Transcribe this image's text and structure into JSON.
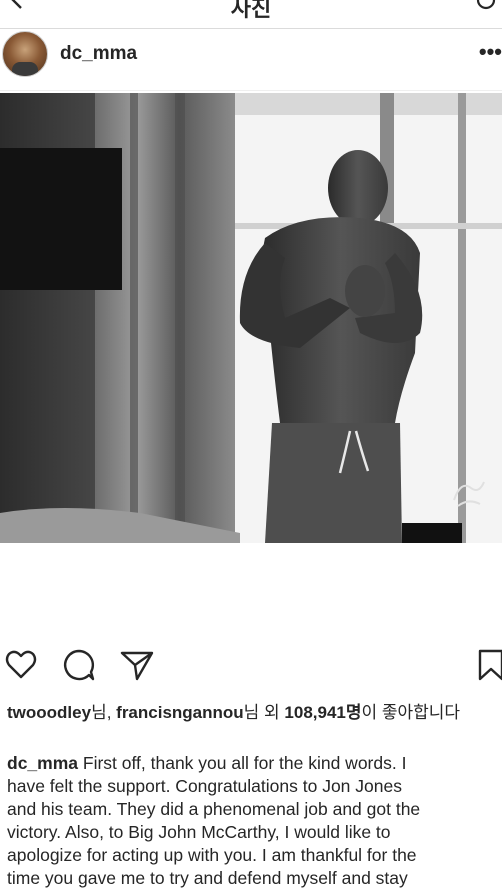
{
  "topbar": {
    "title": "사진",
    "back_icon": "back-arrow-icon",
    "reload_icon": "refresh-icon"
  },
  "post": {
    "username": "dc_mma",
    "more_label": "•••",
    "actions": {
      "like_icon": "heart-icon",
      "comment_icon": "comment-icon",
      "share_icon": "send-icon",
      "save_icon": "bookmark-icon"
    },
    "likes": {
      "user1": "twooodley",
      "suffix1": "님, ",
      "user2": "francisngannou",
      "middle": "님 외 ",
      "count": "108,941명",
      "end": "이 좋아합니다"
    },
    "caption": {
      "user": "dc_mma",
      "lines": [
        " First off, thank you all for the kind words. I",
        "have felt the support. Congratulations to Jon Jones",
        "and his team. They did a phenomenal job and got the",
        "victory. Also, to Big John McCarthy, I would like to",
        "apologize for acting up with you. I am thankful for the",
        "time you gave me to try and defend myself and stay"
      ]
    }
  }
}
